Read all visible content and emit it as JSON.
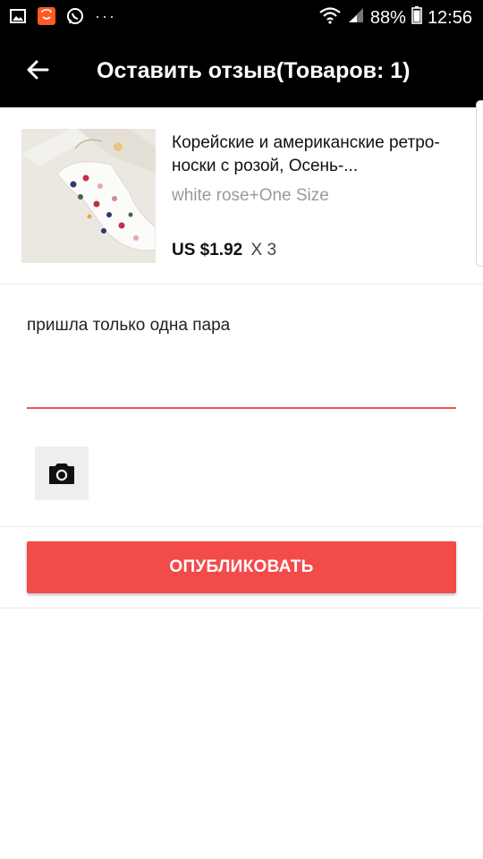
{
  "status_bar": {
    "battery": "88%",
    "time": "12:56",
    "more_dots": "···"
  },
  "header": {
    "title": "Оставить отзыв(Товаров: 1)"
  },
  "product": {
    "title": "Корейские и американские ретро-носки с розой, Осень-...",
    "variant": "white rose+One Size",
    "price": "US $1.92",
    "quantity": "X 3"
  },
  "review": {
    "text": "пришла только одна пара"
  },
  "actions": {
    "publish_label": "ОПУБЛИКОВАТЬ"
  },
  "colors": {
    "accent": "#f34a4a",
    "underline": "#f0544f",
    "bar": "#000000"
  }
}
